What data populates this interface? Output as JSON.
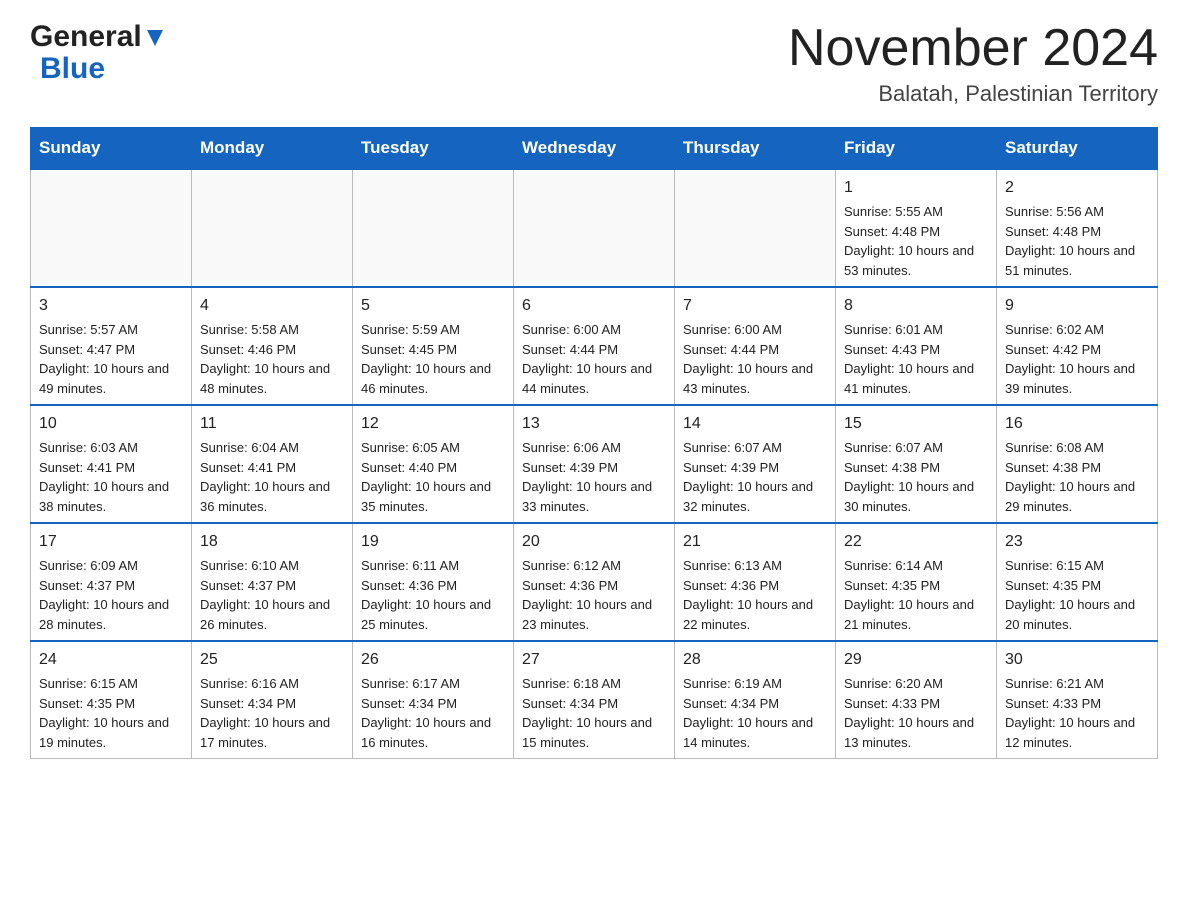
{
  "header": {
    "logo_general": "General",
    "logo_blue": "Blue",
    "title": "November 2024",
    "subtitle": "Balatah, Palestinian Territory"
  },
  "weekdays": [
    "Sunday",
    "Monday",
    "Tuesday",
    "Wednesday",
    "Thursday",
    "Friday",
    "Saturday"
  ],
  "weeks": [
    [
      {
        "day": "",
        "info": ""
      },
      {
        "day": "",
        "info": ""
      },
      {
        "day": "",
        "info": ""
      },
      {
        "day": "",
        "info": ""
      },
      {
        "day": "",
        "info": ""
      },
      {
        "day": "1",
        "info": "Sunrise: 5:55 AM\nSunset: 4:48 PM\nDaylight: 10 hours and 53 minutes."
      },
      {
        "day": "2",
        "info": "Sunrise: 5:56 AM\nSunset: 4:48 PM\nDaylight: 10 hours and 51 minutes."
      }
    ],
    [
      {
        "day": "3",
        "info": "Sunrise: 5:57 AM\nSunset: 4:47 PM\nDaylight: 10 hours and 49 minutes."
      },
      {
        "day": "4",
        "info": "Sunrise: 5:58 AM\nSunset: 4:46 PM\nDaylight: 10 hours and 48 minutes."
      },
      {
        "day": "5",
        "info": "Sunrise: 5:59 AM\nSunset: 4:45 PM\nDaylight: 10 hours and 46 minutes."
      },
      {
        "day": "6",
        "info": "Sunrise: 6:00 AM\nSunset: 4:44 PM\nDaylight: 10 hours and 44 minutes."
      },
      {
        "day": "7",
        "info": "Sunrise: 6:00 AM\nSunset: 4:44 PM\nDaylight: 10 hours and 43 minutes."
      },
      {
        "day": "8",
        "info": "Sunrise: 6:01 AM\nSunset: 4:43 PM\nDaylight: 10 hours and 41 minutes."
      },
      {
        "day": "9",
        "info": "Sunrise: 6:02 AM\nSunset: 4:42 PM\nDaylight: 10 hours and 39 minutes."
      }
    ],
    [
      {
        "day": "10",
        "info": "Sunrise: 6:03 AM\nSunset: 4:41 PM\nDaylight: 10 hours and 38 minutes."
      },
      {
        "day": "11",
        "info": "Sunrise: 6:04 AM\nSunset: 4:41 PM\nDaylight: 10 hours and 36 minutes."
      },
      {
        "day": "12",
        "info": "Sunrise: 6:05 AM\nSunset: 4:40 PM\nDaylight: 10 hours and 35 minutes."
      },
      {
        "day": "13",
        "info": "Sunrise: 6:06 AM\nSunset: 4:39 PM\nDaylight: 10 hours and 33 minutes."
      },
      {
        "day": "14",
        "info": "Sunrise: 6:07 AM\nSunset: 4:39 PM\nDaylight: 10 hours and 32 minutes."
      },
      {
        "day": "15",
        "info": "Sunrise: 6:07 AM\nSunset: 4:38 PM\nDaylight: 10 hours and 30 minutes."
      },
      {
        "day": "16",
        "info": "Sunrise: 6:08 AM\nSunset: 4:38 PM\nDaylight: 10 hours and 29 minutes."
      }
    ],
    [
      {
        "day": "17",
        "info": "Sunrise: 6:09 AM\nSunset: 4:37 PM\nDaylight: 10 hours and 28 minutes."
      },
      {
        "day": "18",
        "info": "Sunrise: 6:10 AM\nSunset: 4:37 PM\nDaylight: 10 hours and 26 minutes."
      },
      {
        "day": "19",
        "info": "Sunrise: 6:11 AM\nSunset: 4:36 PM\nDaylight: 10 hours and 25 minutes."
      },
      {
        "day": "20",
        "info": "Sunrise: 6:12 AM\nSunset: 4:36 PM\nDaylight: 10 hours and 23 minutes."
      },
      {
        "day": "21",
        "info": "Sunrise: 6:13 AM\nSunset: 4:36 PM\nDaylight: 10 hours and 22 minutes."
      },
      {
        "day": "22",
        "info": "Sunrise: 6:14 AM\nSunset: 4:35 PM\nDaylight: 10 hours and 21 minutes."
      },
      {
        "day": "23",
        "info": "Sunrise: 6:15 AM\nSunset: 4:35 PM\nDaylight: 10 hours and 20 minutes."
      }
    ],
    [
      {
        "day": "24",
        "info": "Sunrise: 6:15 AM\nSunset: 4:35 PM\nDaylight: 10 hours and 19 minutes."
      },
      {
        "day": "25",
        "info": "Sunrise: 6:16 AM\nSunset: 4:34 PM\nDaylight: 10 hours and 17 minutes."
      },
      {
        "day": "26",
        "info": "Sunrise: 6:17 AM\nSunset: 4:34 PM\nDaylight: 10 hours and 16 minutes."
      },
      {
        "day": "27",
        "info": "Sunrise: 6:18 AM\nSunset: 4:34 PM\nDaylight: 10 hours and 15 minutes."
      },
      {
        "day": "28",
        "info": "Sunrise: 6:19 AM\nSunset: 4:34 PM\nDaylight: 10 hours and 14 minutes."
      },
      {
        "day": "29",
        "info": "Sunrise: 6:20 AM\nSunset: 4:33 PM\nDaylight: 10 hours and 13 minutes."
      },
      {
        "day": "30",
        "info": "Sunrise: 6:21 AM\nSunset: 4:33 PM\nDaylight: 10 hours and 12 minutes."
      }
    ]
  ]
}
